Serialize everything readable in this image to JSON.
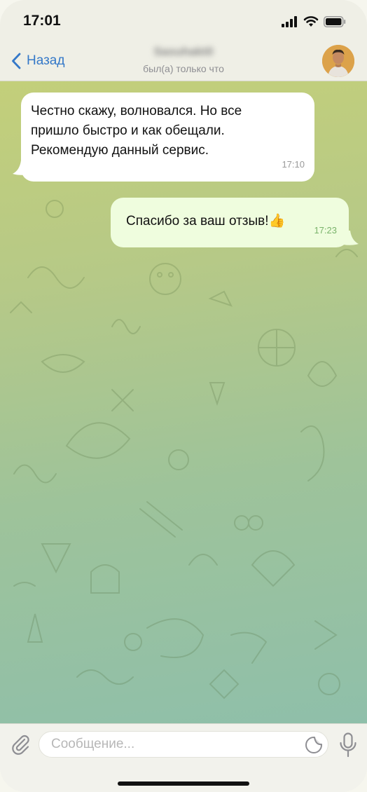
{
  "status_bar": {
    "time": "17:01"
  },
  "header": {
    "back_label": "Назад",
    "contact_name": "Sasuhakt0",
    "contact_status": "был(а) только что"
  },
  "messages": [
    {
      "direction": "incoming",
      "lines": [
        "Честно скажу, волновался. Но все",
        "пришло быстро и как обещали.",
        "Рекомендую данный сервис."
      ],
      "time": "17:10"
    },
    {
      "direction": "outgoing",
      "text": "Спасибо за ваш отзыв!👍",
      "time": "17:23"
    }
  ],
  "input": {
    "placeholder": "Сообщение..."
  },
  "colors": {
    "accent": "#3478c8",
    "incoming_bubble": "#ffffff",
    "outgoing_bubble": "#effdde",
    "outgoing_time": "#7ab36b"
  },
  "icons": [
    "back-chevron-icon",
    "signal-icon",
    "wifi-icon",
    "battery-icon",
    "paperclip-icon",
    "sticker-icon",
    "microphone-icon"
  ]
}
